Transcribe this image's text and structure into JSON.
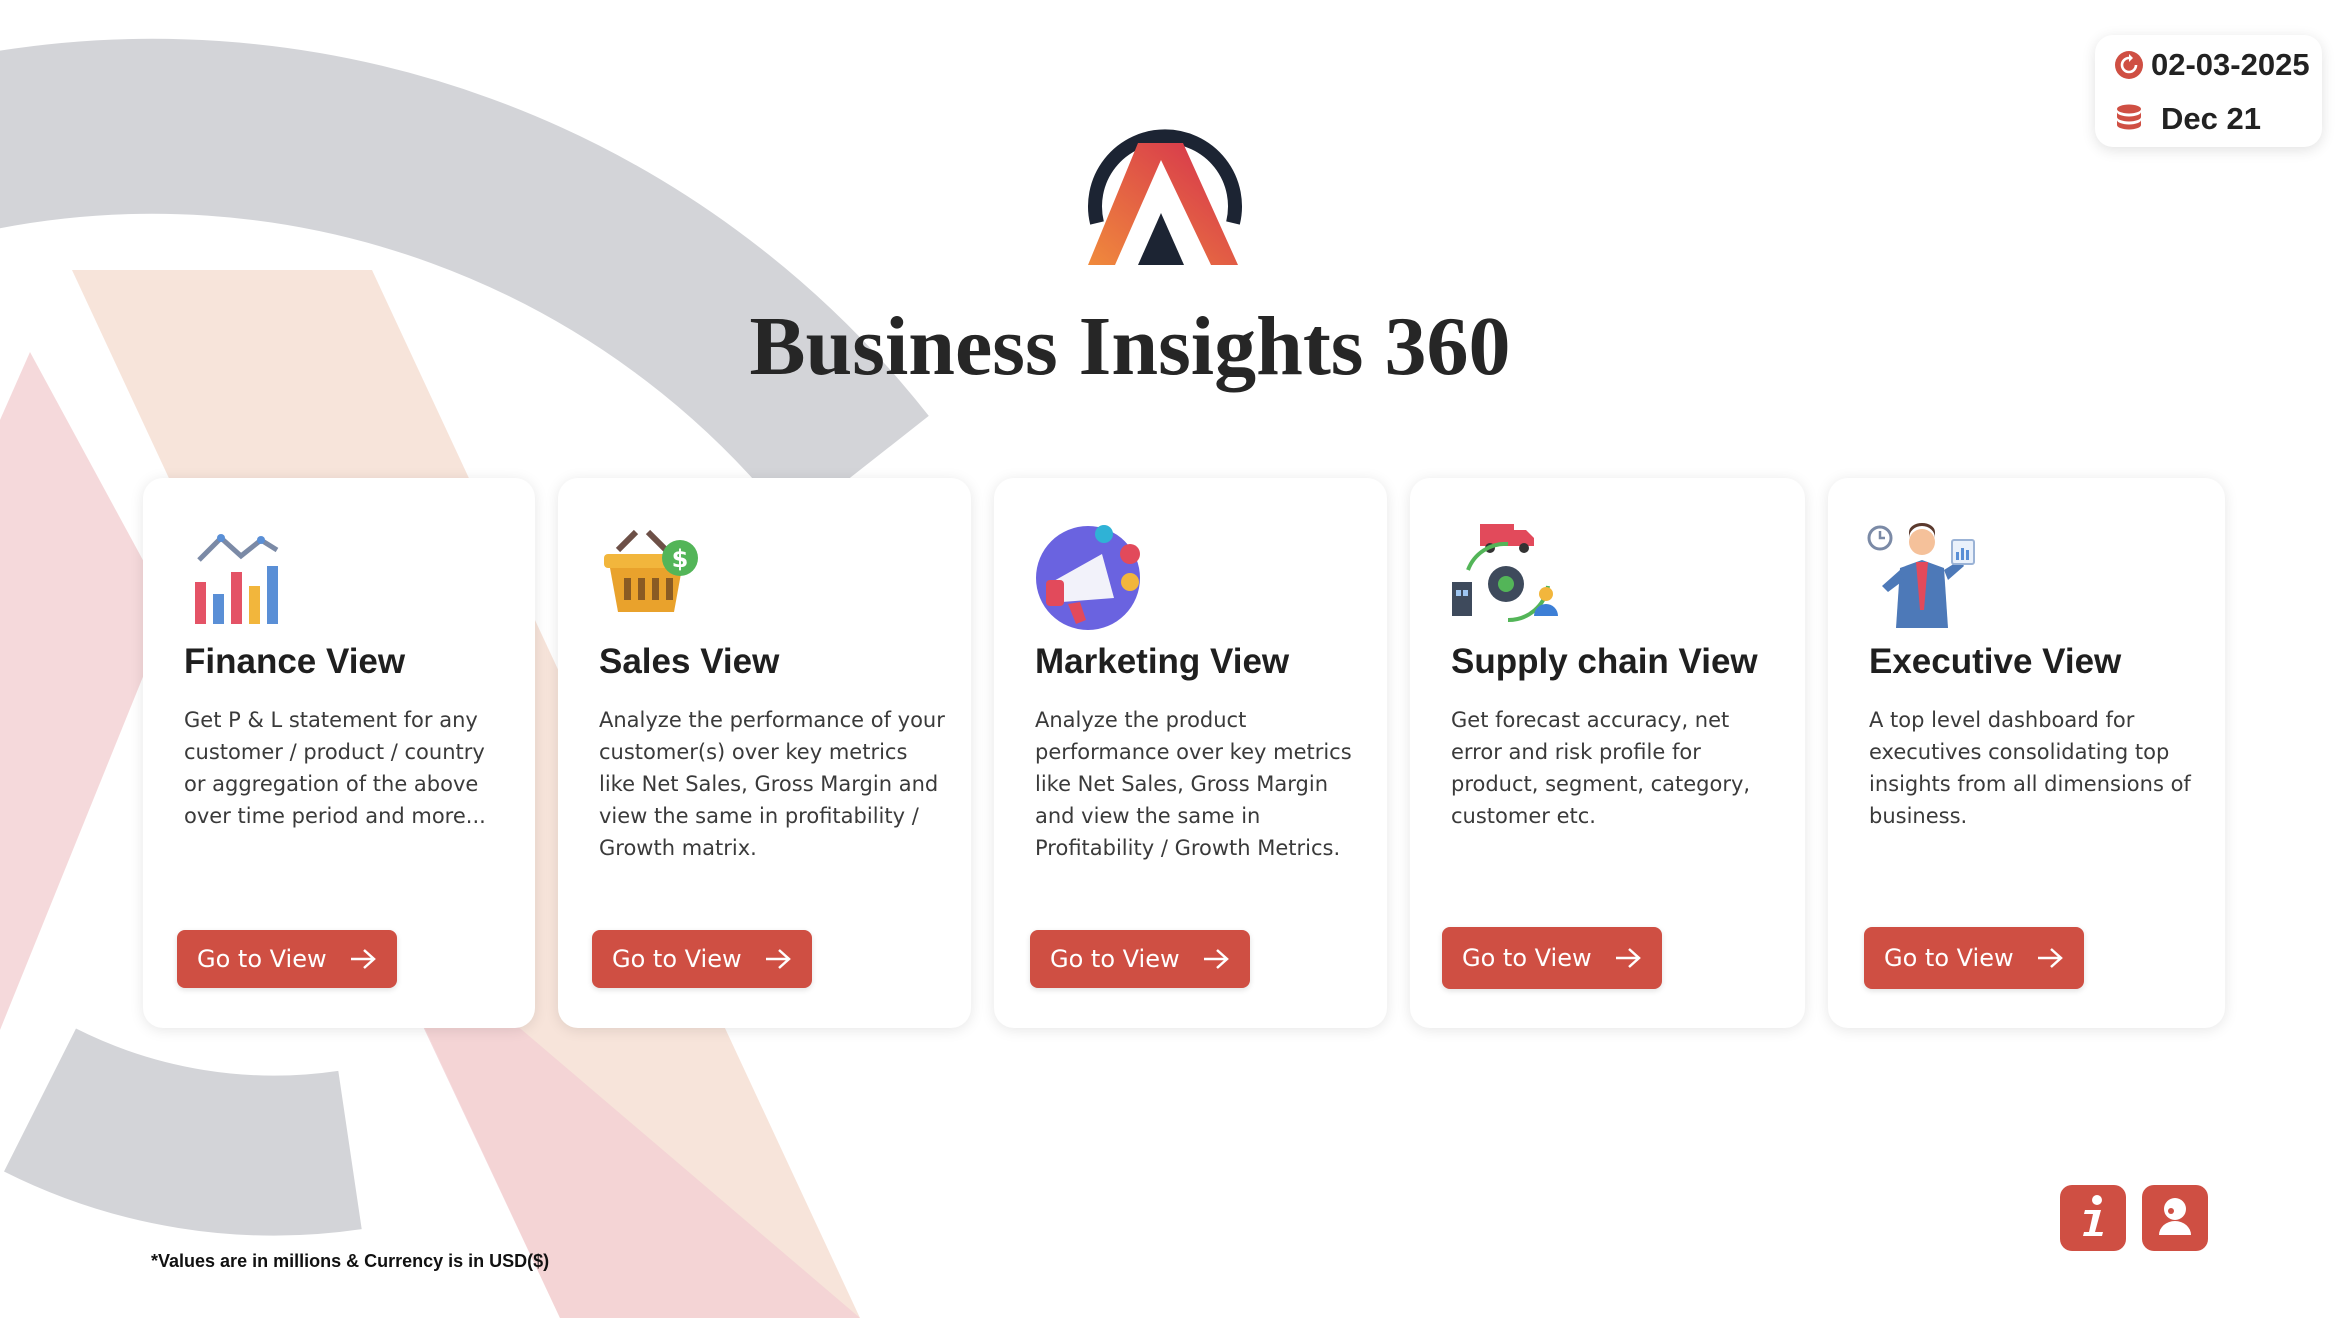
{
  "header": {
    "refresh_date": "02-03-2025",
    "data_period": "Dec 21",
    "refresh_icon": "refresh-icon",
    "database_icon": "database-icon"
  },
  "app": {
    "title": "Business Insights 360",
    "logo": "atliq-logo"
  },
  "cards": [
    {
      "heading": "Finance View",
      "description": "Get P & L statement for any customer / product / country or aggregation of the above over time period and more...",
      "button_label": "Go to View",
      "icon": "finance-chart-icon"
    },
    {
      "heading": "Sales View",
      "description": "Analyze the performance of your customer(s) over key metrics like Net Sales, Gross Margin and view the same in profitability / Growth matrix.",
      "button_label": "Go to View",
      "icon": "sales-basket-icon"
    },
    {
      "heading": "Marketing View",
      "description": "Analyze the product performance over key metrics like Net Sales, Gross Margin and view the same in Profitability / Growth Metrics.",
      "button_label": "Go to View",
      "icon": "marketing-megaphone-icon"
    },
    {
      "heading": "Supply chain View",
      "description": "Get forecast accuracy, net error and risk profile for product, segment, category, customer etc.",
      "button_label": "Go to View",
      "icon": "supply-chain-icon"
    },
    {
      "heading": "Executive View",
      "description": "A top level dashboard for executives consolidating top insights from all dimensions of business.",
      "button_label": "Go to View",
      "icon": "executive-icon"
    }
  ],
  "footer": {
    "note": "*Values are in millions & Currency is in USD($)",
    "info_icon": "info-icon",
    "support_icon": "support-icon"
  },
  "colors": {
    "accent": "#cf4f43",
    "text": "#262626"
  }
}
